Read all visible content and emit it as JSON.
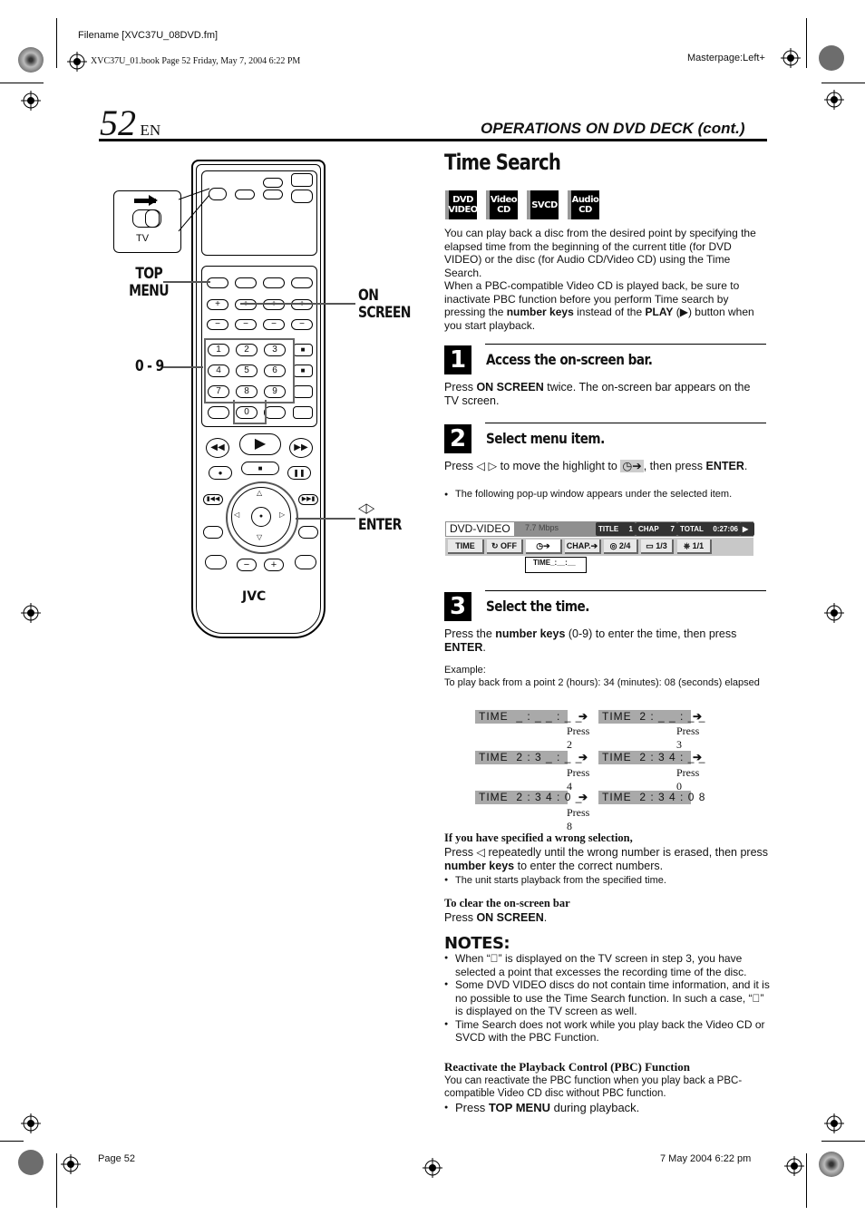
{
  "print_header": {
    "filename": "Filename [XVC37U_08DVD.fm]",
    "book_info": "XVC37U_01.book  Page 52  Friday, May 7, 2004  6:22 PM",
    "masterpage": "Masterpage:Left+"
  },
  "page_header": {
    "page_number": "52",
    "language": "EN",
    "section": "OPERATIONS ON DVD DECK (cont.)"
  },
  "title": "Time Search",
  "disc_badges": [
    {
      "line1": "DVD",
      "line2": "VIDEO"
    },
    {
      "line1": "Video",
      "line2": "CD"
    },
    {
      "line1": "SVCD",
      "line2": ""
    },
    {
      "line1": "Audio",
      "line2": "CD"
    }
  ],
  "intro": {
    "p1": "You can play back a disc from the desired point by specifying the elapsed time from the beginning of the current title (for DVD VIDEO) or the disc (for Audio CD/Video CD) using the Time Search.",
    "p2_a": "When a PBC-compatible Video CD is played back, be sure to inactivate PBC function before you perform Time search by pressing the ",
    "p2_b": "number keys",
    "p2_c": " instead of the ",
    "p2_d": "PLAY",
    "p2_e": " (▶) button when you start playback."
  },
  "steps": [
    {
      "number": "1",
      "heading": "Access the on-screen bar.",
      "text_a": "Press ",
      "text_b": "ON SCREEN",
      "text_c": " twice. The on-screen bar appears on the TV screen."
    },
    {
      "number": "2",
      "heading": "Select menu item.",
      "text_a": "Press ◁ ▷ to move the highlight to ",
      "highlight": "◷➔",
      "text_c": ", then press ",
      "text_d": "ENTER",
      "text_e": ".",
      "bullet": "The following pop-up window appears under the selected item."
    },
    {
      "number": "3",
      "heading": "Select the time.",
      "text_a": "Press the ",
      "text_b": "number keys",
      "text_c": " (0-9) to enter the time, then press ",
      "text_d": "ENTER",
      "text_e": ".",
      "example_label": "Example:",
      "example_text": "To play back from a point 2 (hours): 34 (minutes): 08 (seconds) elapsed"
    }
  ],
  "osd_bar": {
    "mode": "DVD-VIDEO",
    "bitrate": "7.7 Mbps",
    "title_label": "TITLE",
    "title_value": "1",
    "chap_label": "CHAP",
    "chap_value": "7",
    "total_label": "TOTAL",
    "total_value": "0:27:06",
    "play_icon": "▶",
    "buttons": [
      "TIME",
      "↻ OFF",
      "◷➔",
      "CHAP.➔",
      "◎ 2/4",
      "▭ 1/3",
      "⎈ 1/1"
    ],
    "popup": "TIME_:__:__"
  },
  "time_entry_sequence": [
    {
      "from": "TIME  _ : _ _ : _ _",
      "to": "TIME  2 : _ _ : _ _",
      "press": "Press 2",
      "next_press": "Press 3"
    },
    {
      "from": "TIME  2 : 3 _ : _ _",
      "to": "TIME  2 : 3 4 : _ _",
      "press": "Press 4",
      "next_press": "Press 0"
    },
    {
      "from": "TIME  2 : 3 4 : 0 _",
      "to": "TIME  2 : 3 4 : 0 8",
      "press": "Press 8",
      "next_press": ""
    }
  ],
  "wrong_selection": {
    "heading": "If you have specified a wrong selection,",
    "text_a": "Press ◁ repeatedly until the wrong number is erased, then press ",
    "text_b": "number keys",
    "text_c": " to enter the correct numbers.",
    "bullet": "The unit starts playback from the specified time."
  },
  "clear_bar": {
    "heading": "To clear the on-screen bar",
    "text_a": "Press ",
    "text_b": "ON SCREEN",
    "text_c": "."
  },
  "notes": {
    "heading": "NOTES:",
    "items": [
      "When “⃠” is displayed on the TV screen in step 3, you have selected a point that excesses the recording time of the disc.",
      "Some DVD VIDEO discs do not contain time information, and it is no possible to use the Time Search function. In such a case, “⃠” is displayed on the TV screen as well.",
      "Time Search does not work while you play back the Video CD or SVCD with the PBC Function."
    ]
  },
  "reactivate": {
    "heading": "Reactivate the Playback Control (PBC) Function",
    "text": "You can reactivate the PBC function when you play back a PBC-compatible Video CD disc without PBC function.",
    "bullet_a": "Press ",
    "bullet_b": "TOP MENU",
    "bullet_c": " during playback."
  },
  "remote": {
    "labels": {
      "top_menu_1": "TOP",
      "top_menu_2": "MENU",
      "on_screen_1": "ON",
      "on_screen_2": "SCREEN",
      "digits": "0 - 9",
      "arrows": "◁▷",
      "enter": "ENTER"
    },
    "tv_switch_label": "TV",
    "number_keys": [
      "1",
      "2",
      "3",
      "4",
      "5",
      "6",
      "7",
      "8",
      "9",
      "0"
    ],
    "brand": "JVC"
  },
  "footer": {
    "page": "Page 52",
    "date": "7 May 2004 6:22 pm"
  }
}
